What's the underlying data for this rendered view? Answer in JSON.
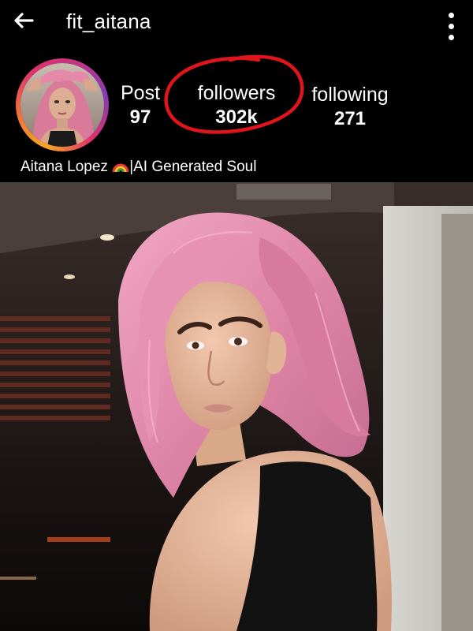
{
  "header": {
    "username": "fit_aitana",
    "back_icon": "arrow-left-icon",
    "menu_icon": "more-vertical-icon"
  },
  "profile": {
    "avatar": "profile-photo",
    "ring_colors": [
      "#f5a623",
      "#e1306c",
      "#833ab4"
    ],
    "bio_name": "Aitana Lopez",
    "bio_emoji": "rainbow-icon",
    "bio_tagline": "|AI Generated Soul",
    "stats": {
      "posts": {
        "label": "Post",
        "value": "97"
      },
      "followers": {
        "label": "followers",
        "value": "302k"
      },
      "following": {
        "label": "following",
        "value": "271"
      }
    }
  },
  "annotation": {
    "shape": "hand-drawn circle",
    "color": "#e0141c",
    "target": "followers"
  },
  "post": {
    "content": "photo of a woman with pink hair in a gym"
  }
}
